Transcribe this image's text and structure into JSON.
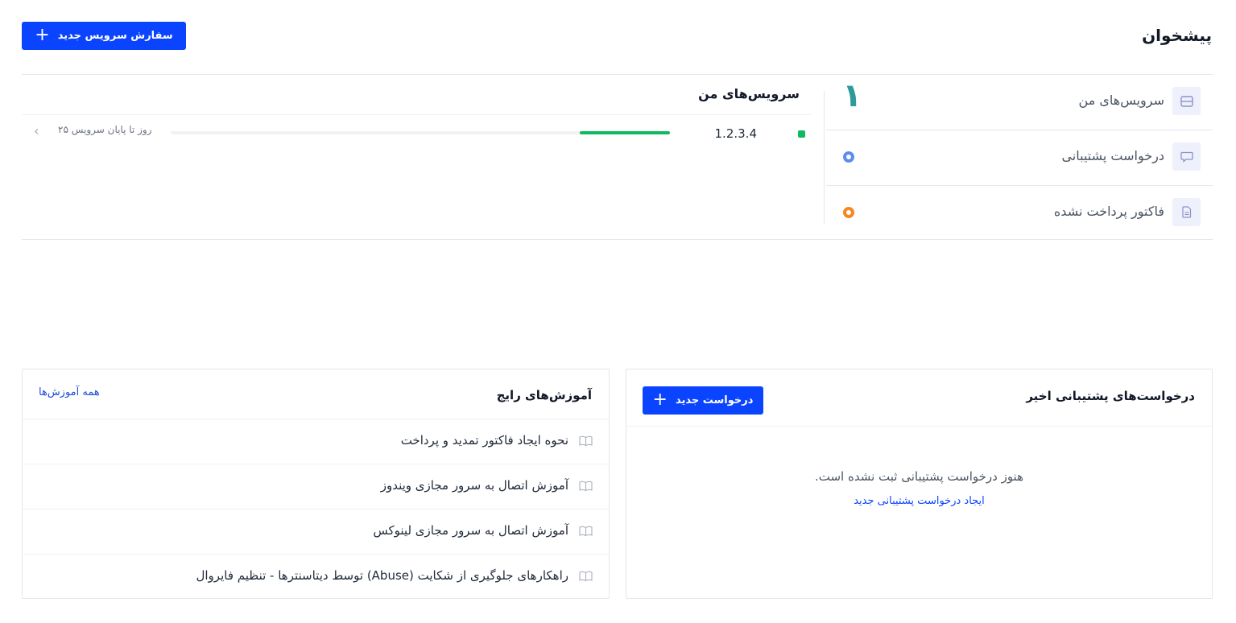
{
  "header": {
    "title": "پیشخوان",
    "order_button_label": "سفارش سرویس جدید"
  },
  "stats": [
    {
      "label": "سرویس‌های من",
      "value": "۱",
      "icon": "server-icon"
    },
    {
      "label": "درخواست پشتیبانی",
      "value": "",
      "indicator_color": "#5b8def",
      "icon": "chat-icon"
    },
    {
      "label": "فاکتور پرداخت نشده",
      "value": "",
      "indicator_color": "#f5881f",
      "icon": "invoice-icon"
    }
  ],
  "services": {
    "title": "سرویس‌های من",
    "items": [
      {
        "ip": "1.2.3.4",
        "status_color": "#10b95e",
        "days_left_text": "۲۵ روز تا پایان سرویس",
        "progress": 0.18
      }
    ]
  },
  "support": {
    "title": "درخواست‌های پشتیبانی اخیر",
    "new_button_label": "درخواست جدید",
    "empty_text": "هنوز درخواست پشتیبانی ثبت نشده است.",
    "empty_link": "ایجاد درخواست پشتیبانی جدید"
  },
  "tutorials": {
    "title": "آموزش‌های رایج",
    "all_link": "همه آموزش‌ها",
    "items": [
      {
        "label": "نحوه ایجاد فاکتور تمدید و پرداخت"
      },
      {
        "label": "آموزش اتصال به سرور مجازی ویندوز"
      },
      {
        "label": "آموزش اتصال به سرور مجازی لینوکس"
      },
      {
        "label": "راهکارهای جلوگیری از شکایت (Abuse) توسط دیتاسنترها - تنظیم فایروال"
      }
    ]
  },
  "colors": {
    "primary": "#0b44ff",
    "success": "#10b95e",
    "count": "#2f9a9a"
  }
}
